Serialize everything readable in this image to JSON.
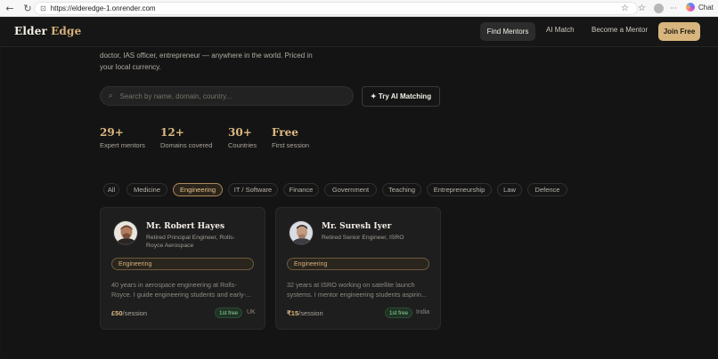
{
  "browser": {
    "url": "https://elderedge-1.onrender.com",
    "chat_label": "Chat",
    "back_icon": "←",
    "reload_icon": "↻",
    "lock_icon": "⊡",
    "star_icon": "☆",
    "collections_icon": "☆",
    "more_icon": "···"
  },
  "nav": {
    "logo_primary": "Elder",
    "logo_accent": "Edge",
    "find_mentors": "Find Mentors",
    "ai_match": "AI Match",
    "become_mentor": "Become a Mentor",
    "join_free": "Join Free"
  },
  "hero": {
    "intro_line1": "doctor, IAS officer, entrepreneur — anywhere in the world. Priced in",
    "intro_line2": "your local currency.",
    "search_placeholder": "Search by name, domain, country...",
    "search_icon": "⌕",
    "ai_button": "✦ Try AI Matching"
  },
  "stats": [
    {
      "value": "29+",
      "label": "Expert mentors"
    },
    {
      "value": "12+",
      "label": "Domains covered"
    },
    {
      "value": "30+",
      "label": "Countries"
    },
    {
      "value": "Free",
      "label": "First session"
    }
  ],
  "filters": {
    "all": "All",
    "medicine": "Medicine",
    "engineering": "Engineering",
    "it": "IT / Software",
    "finance": "Finance",
    "government": "Government",
    "teaching": "Teaching",
    "entrepreneurship": "Entrepreneurship",
    "law": "Law",
    "defence": "Defence"
  },
  "mentors": [
    {
      "name": "Mr. Robert Hayes",
      "role_line1": "Retired Principal Engineer, Rolls-",
      "role_line2": "Royce Aerospace",
      "tag": "Engineering",
      "desc_line1": "40 years in aerospace engineering at Rolls-",
      "desc_line2": "Royce. I guide engineering students and early-...",
      "price": "£50",
      "per": "/session",
      "free": "1st free",
      "country": "UK"
    },
    {
      "name": "Mr. Suresh Iyer",
      "role_line1": "Retired Senior Engineer, ISRO",
      "role_line2": "",
      "tag": "Engineering",
      "desc_line1": "32 years at ISRO working on satellite launch",
      "desc_line2": "systems. I mentor engineering students aspirin...",
      "price": "₹15",
      "per": "/session",
      "free": "1st free",
      "country": "India"
    }
  ]
}
